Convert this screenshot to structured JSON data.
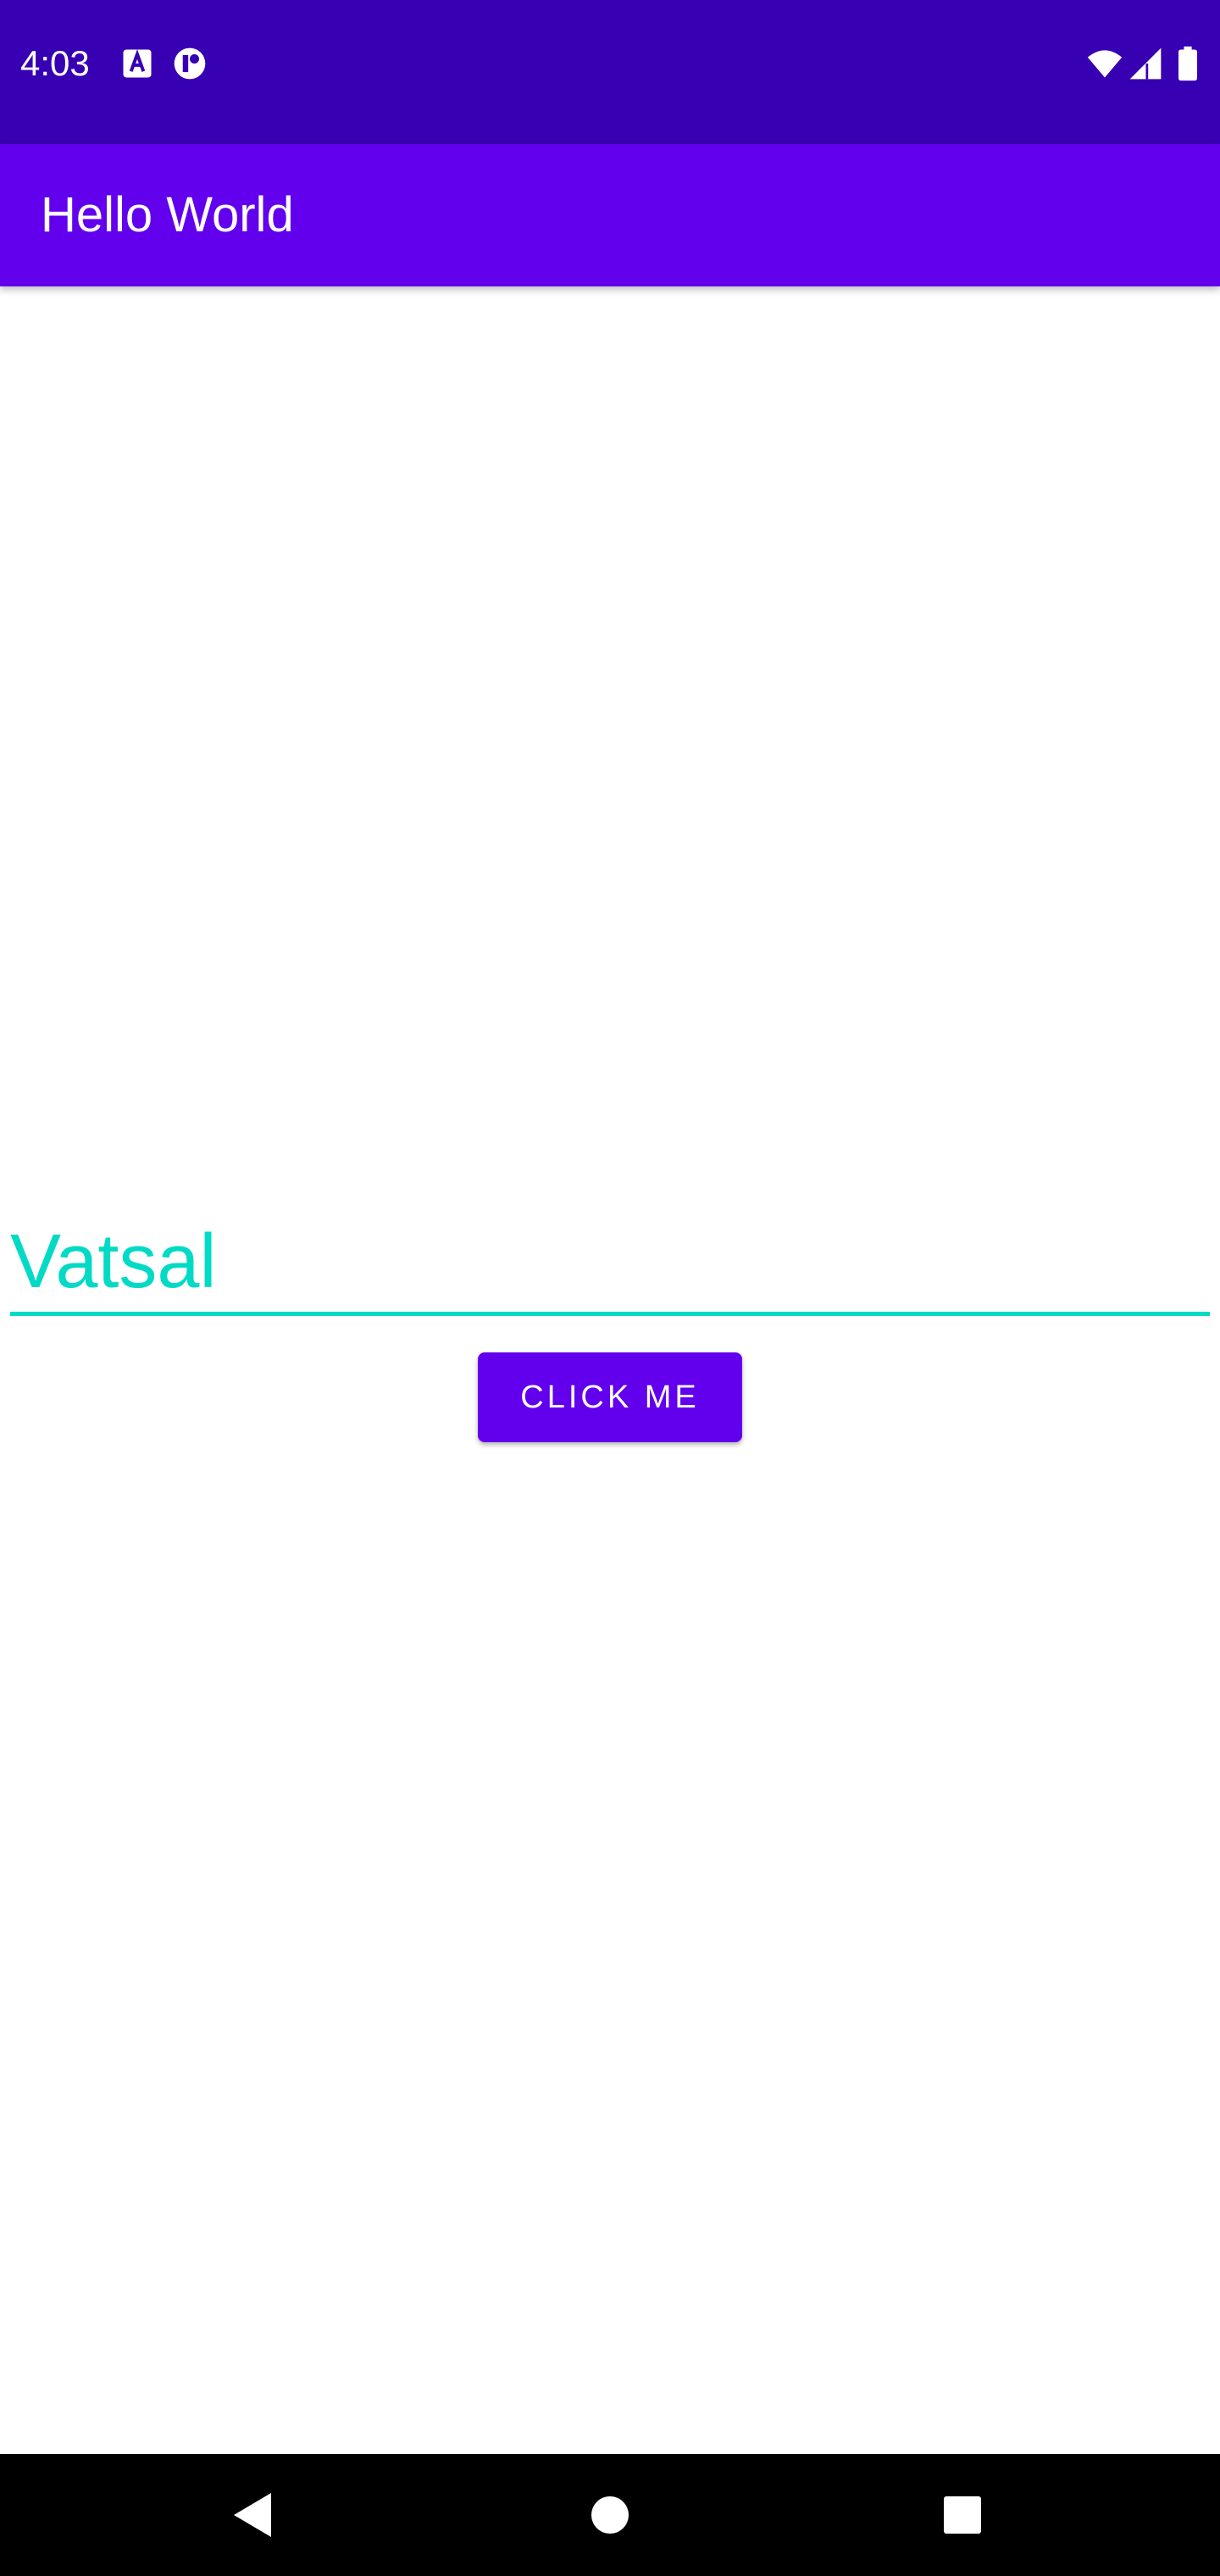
{
  "status_bar": {
    "time": "4:03",
    "left_icons": [
      "autofill-a-icon",
      "notification-app-icon"
    ],
    "right_icons": [
      "wifi-icon",
      "cell-signal-icon",
      "battery-icon"
    ],
    "background_color": "#3700b3"
  },
  "app_bar": {
    "title": "Hello World",
    "background_color": "#6200ee"
  },
  "main": {
    "name_input": {
      "value": "Vatsal",
      "color": "#03dac5"
    },
    "click_button": {
      "label": "CLICK ME",
      "background_color": "#6200ee"
    }
  },
  "nav_bar": {
    "buttons": [
      "back-icon",
      "home-icon",
      "recents-icon"
    ]
  }
}
